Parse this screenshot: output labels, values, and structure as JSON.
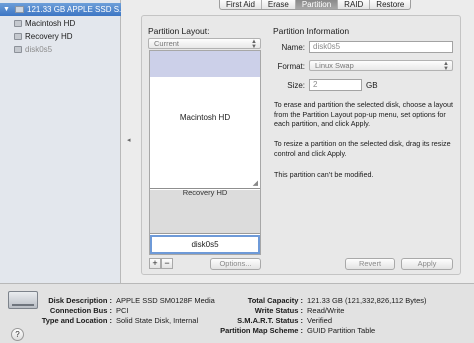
{
  "sidebar": {
    "disk": "121.33 GB APPLE SSD S...",
    "volumes": [
      {
        "label": "Macintosh HD",
        "dim": false
      },
      {
        "label": "Recovery HD",
        "dim": false
      },
      {
        "label": "disk0s5",
        "dim": true
      }
    ]
  },
  "tabs": [
    {
      "label": "First Aid",
      "active": false
    },
    {
      "label": "Erase",
      "active": false
    },
    {
      "label": "Partition",
      "active": true
    },
    {
      "label": "RAID",
      "active": false
    },
    {
      "label": "Restore",
      "active": false
    }
  ],
  "layout": {
    "title": "Partition Layout:",
    "popup": "Current",
    "partitions": [
      "Macintosh HD",
      "Recovery HD",
      "disk0s5"
    ],
    "add_label": "+",
    "remove_label": "−",
    "options_label": "Options...",
    "revert_label": "Revert",
    "apply_label": "Apply"
  },
  "info": {
    "title": "Partition Information",
    "name_label": "Name:",
    "name_value": "disk0s5",
    "format_label": "Format:",
    "format_value": "Linux Swap",
    "size_label": "Size:",
    "size_value": "2",
    "size_unit": "GB",
    "desc1": "To erase and partition the selected disk, choose a layout from the Partition Layout pop-up menu, set options for each partition, and click Apply.",
    "desc2": "To resize a partition on the selected disk, drag its resize control and click Apply.",
    "desc3": "This partition can’t be modified."
  },
  "details": {
    "disk_description_label": "Disk Description :",
    "disk_description": "APPLE SSD SM0128F Media",
    "connection_bus_label": "Connection Bus :",
    "connection_bus": "PCI",
    "type_location_label": "Type and Location :",
    "type_location": "Solid State Disk, Internal",
    "total_capacity_label": "Total Capacity :",
    "total_capacity": "121.33 GB (121,332,826,112 Bytes)",
    "write_status_label": "Write Status :",
    "write_status": "Read/Write",
    "smart_status_label": "S.M.A.R.T. Status :",
    "smart_status": "Verified",
    "partition_map_label": "Partition Map Scheme :",
    "partition_map": "GUID Partition Table"
  },
  "help_label": "?"
}
